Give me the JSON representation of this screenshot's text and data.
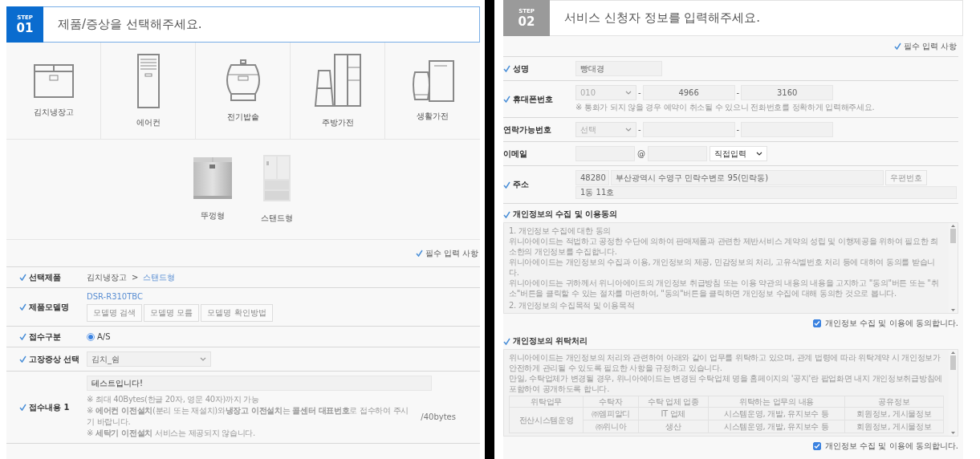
{
  "step1": {
    "badge": "STEP",
    "number": "01",
    "title": "제품/증상을 선택해주세요.",
    "current": true,
    "categories": [
      {
        "kind": "kimchi-fridge",
        "label": "김치냉장고"
      },
      {
        "kind": "air-conditioner",
        "label": "에어컨"
      },
      {
        "kind": "rice-cooker",
        "label": "전기밥솥"
      },
      {
        "kind": "kitchen",
        "label": "주방가전"
      },
      {
        "kind": "living",
        "label": "생활가전"
      }
    ],
    "subtypes": [
      {
        "kind": "chest",
        "label": "뚜껑형"
      },
      {
        "kind": "stand",
        "label": "스탠드형"
      }
    ],
    "required_note": "필수 입력 사항",
    "fields": [
      {
        "kind": "breadcrumb",
        "label": "선택제품",
        "required": true,
        "path": [
          "김치냉장고",
          "스탠드형"
        ],
        "separator": ">"
      },
      {
        "kind": "model",
        "label": "제품모델명",
        "required": true,
        "value": "DSR-R310TBC",
        "buttons": [
          "모델명 검색",
          "모델명 모름",
          "모델명 확인방법"
        ]
      },
      {
        "kind": "radio",
        "label": "접수구분",
        "required": true,
        "options": [
          {
            "label": "A/S",
            "selected": true
          }
        ]
      },
      {
        "kind": "select",
        "label": "고장증상 선택",
        "required": true,
        "value": "김치_쉼"
      },
      {
        "kind": "textarea",
        "label": "접수내용 1",
        "required": true,
        "value": "테스트입니다!",
        "counter": "/40bytes",
        "notes": [
          "※ 최대 40Bytes(한글 20자, 영문 40자)까지 가능",
          "※ **에어컨 이전설치**(분리 또는 재설치)와**냉장고 이전설치**는 **콜센터 대표번호**로 접수하여 주시기 바랍니다.",
          "※ **세탁기 이전설치** 서비스는 제공되지 않습니다."
        ]
      }
    ]
  },
  "step2": {
    "badge": "STEP",
    "number": "02",
    "title": "서비스 신청자 정보를 입력해주세요.",
    "current": false,
    "required_note": "필수 입력 사항",
    "fields": [
      {
        "kind": "text",
        "label": "성명",
        "required": true,
        "value": "빵대경"
      },
      {
        "kind": "phone",
        "label": "휴대폰번호",
        "required": true,
        "prefix": "010",
        "separator": "-",
        "parts": [
          "4966",
          "3160"
        ],
        "note": "※ 통화가 되지 않을 경우 예약이 취소될 수 있으니 전화번호를 정확하게 입력해주세요."
      },
      {
        "kind": "phone",
        "label": "연락가능번호",
        "required": false,
        "prefix": "선택",
        "separator": "-"
      },
      {
        "kind": "email",
        "label": "이메일",
        "required": false,
        "at": "@",
        "domain": "직접입력"
      },
      {
        "kind": "address",
        "label": "주소",
        "required": true,
        "zipcode": "48280",
        "address": "부산광역시 수영구 민락수변로 95(민락동)",
        "button": "우편번호",
        "detail": "1동 11호"
      }
    ],
    "agreements": [
      {
        "title": "개인정보의 수집 및 이용동의",
        "paragraphs": [
          {
            "kind": "heading",
            "text": "1. 개인정보 수집에 대한 동의"
          },
          {
            "kind": "text",
            "text": "위니아에이드는 적법하고 공정한 수단에 의하여 판매제품과 관련한 제반서비스 계약의 성립 및 이행제공을 위하여 필요한 최소한의 개인정보를 수집합니다."
          },
          {
            "kind": "text",
            "text": "위니아에이드는 개인정보의 수집과 이용, 개인정보의 제공, 민감정보의 처리, 고유식별번호 처리 등에 대하여 동의를 받습니다."
          },
          {
            "kind": "text",
            "text": "위니아에이드는 귀하께서 위니아에이드의 개인정보 취급방침 또는 이용 약관의 내용의 내용을 고지하고 \"동의\"버튼 또는 \"취소\"버튼을 클릭할 수 있는 절차를 마련하여, \"동의\"버튼을 클릭하면 개인정보 수집에 대해 동의한 것으로 봅니다."
          },
          {
            "kind": "heading",
            "text": "2. 개인정보의 수집목적 및 이용목적"
          }
        ],
        "consent": {
          "label": "개인정보 수집 및 이용에 동의합니다.",
          "checked": true
        }
      },
      {
        "title": "개인정보의 위탁처리",
        "paragraphs": [
          {
            "kind": "text",
            "text": "위니아에이드는 개인정보의 처리와 관련하여 아래와 같이 업무를 위탁하고 있으며, 관계 법령에 따라 위탁계약 시 개인정보가 안전하게 관리될 수 있도록 필요한 사항을 규정하고 있습니다."
          },
          {
            "kind": "text",
            "text": "만일, 수탁업체가 변경될 경우, 위니아에이드는 변경된 수탁업체 명을 홈페이지의 '공지'란 팝업화면 내지 개인정보취급방침에 포함하여 공개하도록 합니다."
          }
        ],
        "table": {
          "columns": [
            "위탁업무",
            "수탁자",
            "수탁 업체 업종",
            "위탁하는 업무의 내용",
            "공유정보"
          ],
          "groups": [
            {
              "name": "전산시스템운영",
              "rows": [
                [
                  "㈜엠피알디",
                  "IT 업체",
                  "시스템운영, 개발, 유지보수 등",
                  "회원정보, 게시물정보"
                ],
                [
                  "㈜위니아",
                  "생산",
                  "시스템운영, 개발, 유지보수 등",
                  "회원정보, 게시물정보"
                ]
              ]
            }
          ]
        },
        "consent": {
          "label": "개인정보 수집 및 이용에 동의합니다.",
          "checked": true
        }
      }
    ]
  }
}
